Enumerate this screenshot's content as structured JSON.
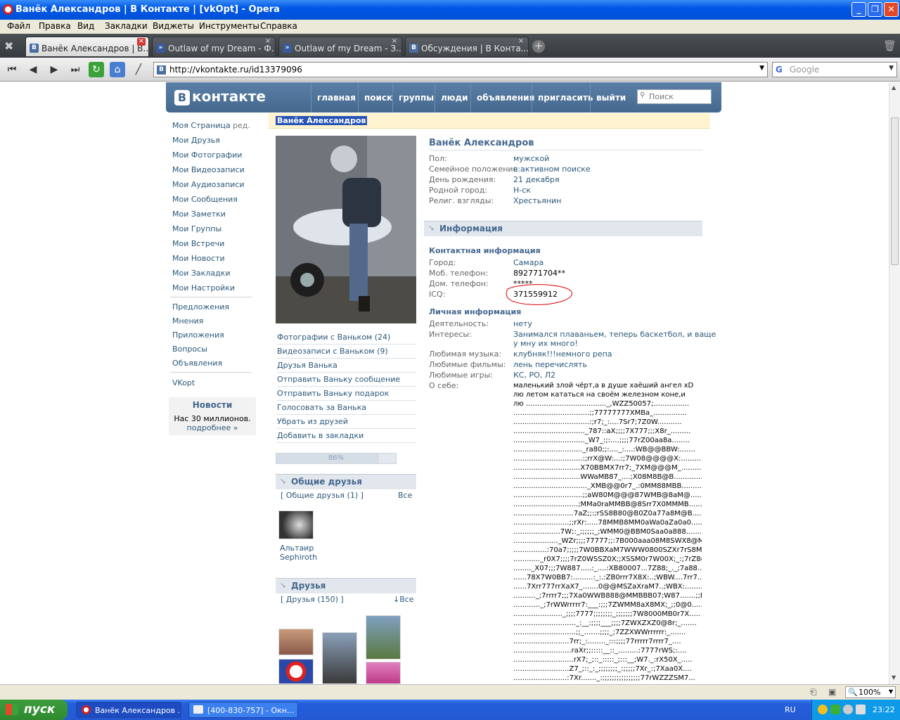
{
  "window": {
    "title": "Ванёк Александров | В Контакте | [vkOpt] - Opera"
  },
  "menu": [
    "Файл",
    "Правка",
    "Вид",
    "Закладки",
    "Виджеты",
    "Инструменты",
    "Справка"
  ],
  "tabs": [
    {
      "label": "Ванёк Александров | В..."
    },
    {
      "label": "Outlaw of my Dream - Ф..."
    },
    {
      "label": "Outlaw of my Dream - З..."
    },
    {
      "label": "Обсуждения | В Конта..."
    }
  ],
  "address": {
    "url": "http://vkontakte.ru/id13379096",
    "search_placeholder": "Google"
  },
  "vk": {
    "logo": "контакте",
    "logo_letter": "В",
    "nav": [
      "главная",
      "поиск",
      "группы",
      "люди",
      "объявления",
      "пригласить",
      "выйти"
    ],
    "search_placeholder": "Поиск",
    "left_nav": [
      "Моя Страница",
      "Мои Друзья",
      "Мои Фотографии",
      "Мои Видеозаписи",
      "Мои Аудиозаписи",
      "Мои Сообщения",
      "Мои Заметки",
      "Мои Группы",
      "Мои Встречи",
      "Мои Новости",
      "Мои Закладки",
      "Мои Настройки"
    ],
    "edit_label": "ред.",
    "left_nav2": [
      "Предложения",
      "Мнения",
      "Приложения",
      "Вопросы",
      "Объявления"
    ],
    "vkopt": "VKopt",
    "news": {
      "title": "Новости",
      "text": "Нас 30 миллионов.",
      "link": "подробнее »"
    },
    "breadcrumb": "Ванёк Александров",
    "profile": {
      "name": "Ванёк Александров",
      "basic": [
        {
          "label": "Пол:",
          "value": "мужской"
        },
        {
          "label": "Семейное положение:",
          "value": "в активном поиске"
        },
        {
          "label": "День рождения:",
          "value": "21 декабря"
        },
        {
          "label": "Родной город:",
          "value": "Н-ск"
        },
        {
          "label": "Религ. взгляды:",
          "value": "Хрестьянин"
        }
      ],
      "info_header": "Информация",
      "contact_title": "Контактная информация",
      "contact": [
        {
          "label": "Город:",
          "value": "Самара"
        },
        {
          "label": "Моб. телефон:",
          "value": "892771704**"
        },
        {
          "label": "Дом. телефон:",
          "value": "*****"
        },
        {
          "label": "ICQ:",
          "value": "371559912"
        }
      ],
      "personal_title": "Личная информация",
      "personal": [
        {
          "label": "Деятельность:",
          "value": "нету"
        },
        {
          "label": "Интересы:",
          "value": "Занимался плаваньем, теперь баскетбол, и ваще"
        },
        {
          "label": "",
          "value": "у мну их много!"
        },
        {
          "label": "Любимая музыка:",
          "value": "клубняк!!!немного репа"
        },
        {
          "label": "Любимые фильмы:",
          "value": "лень перечислять"
        },
        {
          "label": "Любимые игры:",
          "value": "КС, РО, Л2"
        }
      ],
      "about_label": "О себе:",
      "about": [
        "маленький злой чёрт,а в душе хаёший ангел xD",
        "лю летом кататься на своём железном коне,и",
        "лю ...................................._,WZZ50057;................",
        "..................................;;77777777XMBa_...............",
        "..................................:;r7;_:....7Sr7;7Z0W...........",
        "................................_787::aX;;;;7X777;;;X8r_.........",
        "................................_W7_:;:....;;;;77rZ00aa8a........",
        "..............................._ra80;;:...._:....:WB@@BBW:.......",
        "...............................:;rrX@W:...:;7W08@@@@X:..........",
        "..............................X70BBMX7rr7;_7XM@@@M_.............",
        "..............................WWaMB87_....;X08M8B@B.............",
        "................................._XMB@@0r7_.:0MM88MBB...........",
        "...............................;;aW80M@@@87WMB@8aM@.............",
        ".............................;MMa0raMMBB@8Srr7X0MMMB...........",
        "...........................7aZ;;:;rSS8B80@B0Z0a77a8M@B.........",
        ".........................;;rXr:.....78MMB8MM0aWa0aZa0a0.........",
        ".....................7W;:_;;;;;;_;WMM0@BBM0Saa0a888.............",
        "...................._WZr;;;;77777;;:7B000aaa08M8SWX8@M0.........",
        "...............:70a7;;;;;7W0BBXaM7WWW0800SZXr7rS8MB..........",
        "............_r0X7;;;;7rZ0WSSZ0X;;XSSM0r7W00X;_:;7rZ8@..........",
        "........_X07;;;7W887.....:_....:XB80007...7Z88;_._;7a88........",
        "......78X7W0BB7:.........:_:.:ZB0rrr7X8X:..;WBW....7rr7........",
        "......7Xrr777rrXaX7_.......0@@MSZaXraM7..;WBX:.........",
        ".........._;7rrrr7;;;7Xa0WWB888@MMBBB07;W87.......;;B0.........",
        "............_;7rWWrrrrr7:___:;;;7ZWMM8aX8MX;_;;0@0..............",
        "......................_;;;;7777;;;;;;;;_;;;;;;;7W8000MB0r7X.....",
        "............................_:__:;;;;___;;;;7ZWXZXZ0@8r;_.......",
        "............................;;_.......;;;;_;7ZZXWWrrrrrr:_.......",
        ".........................7rr;_:........_:::;;;;77rrrrr7rrrr7_....",
        "..........................raXr;;:::::__::_.........:7777rWS;:....",
        "...........................rX7;_;::_:::::_;:::__;W7._:rX50X_.....",
        ".........................Z7_;::_:_;;;;;;;;_:;;;;;7Xr_:;7Xaa0X....",
        "........................:7Xr......._:;;;;;;;;;;;;;;;;77rWZZZSM7..."
      ]
    },
    "actions": [
      "Фотографии с Ваньком (24)",
      "Видеозаписи с Ваньком (9)",
      "Друзья Ванька",
      "Отправить Ваньку сообщение",
      "Отправить Ваньку подарок",
      "Голосовать за Ванька",
      "Убрать из друзей",
      "Добавить в закладки"
    ],
    "rating": "86%",
    "rating_fill": 0.86,
    "common_friends": {
      "title": "Общие друзья",
      "link": "[ Общие друзья (1) ]",
      "all": "Все",
      "friend_name_1": "Альтаир",
      "friend_name_2": "Sephiroth"
    },
    "friends": {
      "title": "Друзья",
      "link": "[ Друзья (150) ]",
      "all": "↓Все"
    }
  },
  "status": {
    "zoom": "100%"
  },
  "taskbar": {
    "start": "пуск",
    "tasks": [
      "Ванёк Александров ...",
      "[400-830-757] - Окн..."
    ],
    "lang": "RU",
    "time": "23:22"
  },
  "colors": {
    "vk_blue": "#45688e",
    "link": "#2b587a",
    "xp_blue": "#245edb"
  }
}
